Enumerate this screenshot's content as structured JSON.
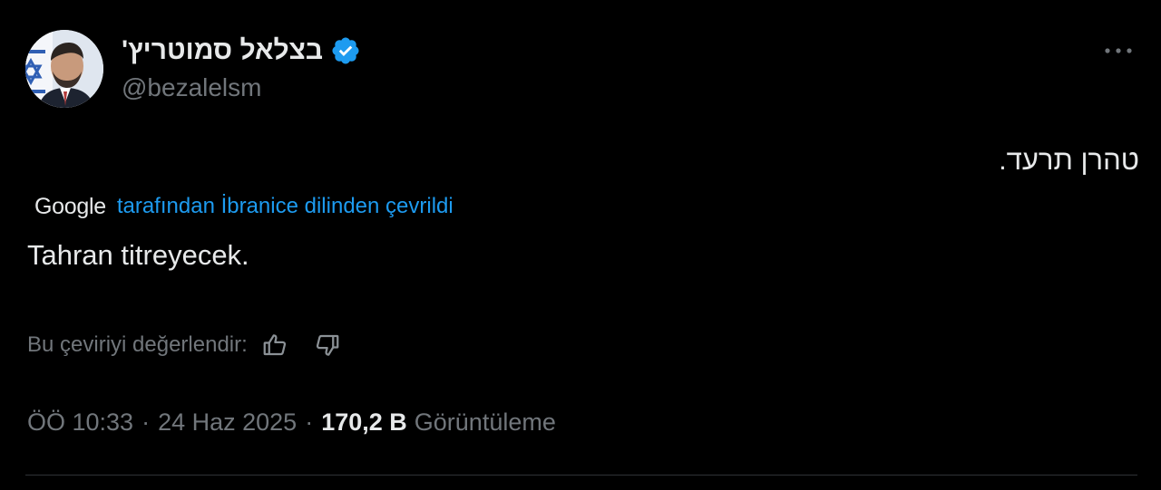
{
  "author": {
    "display_name": "בצלאל סמוטריץ'",
    "handle": "@bezalelsm",
    "verified_icon": "verified-badge-icon",
    "verified_color": "#1d9bf0"
  },
  "more_icon": "more-horizontal-icon",
  "tweet": {
    "original_text": "טהרן תרעד.",
    "translation": {
      "provider": "Google",
      "translated_by_text": "tarafından İbranice dilinden çevrildi",
      "translated_text": "Tahran titreyecek."
    },
    "rate": {
      "label": "Bu çeviriyi değerlendir:",
      "like_icon": "thumbs-up-icon",
      "dislike_icon": "thumbs-down-icon"
    },
    "meta": {
      "time": "ÖÖ 10:33",
      "separator": "·",
      "date": "24 Haz 2025",
      "views_count": "170,2 B",
      "views_label": "Görüntüleme"
    }
  },
  "colors": {
    "background": "#000000",
    "text_primary": "#e7e9ea",
    "text_secondary": "#71767b",
    "link": "#1d9bf0",
    "divider": "#2f3336"
  }
}
